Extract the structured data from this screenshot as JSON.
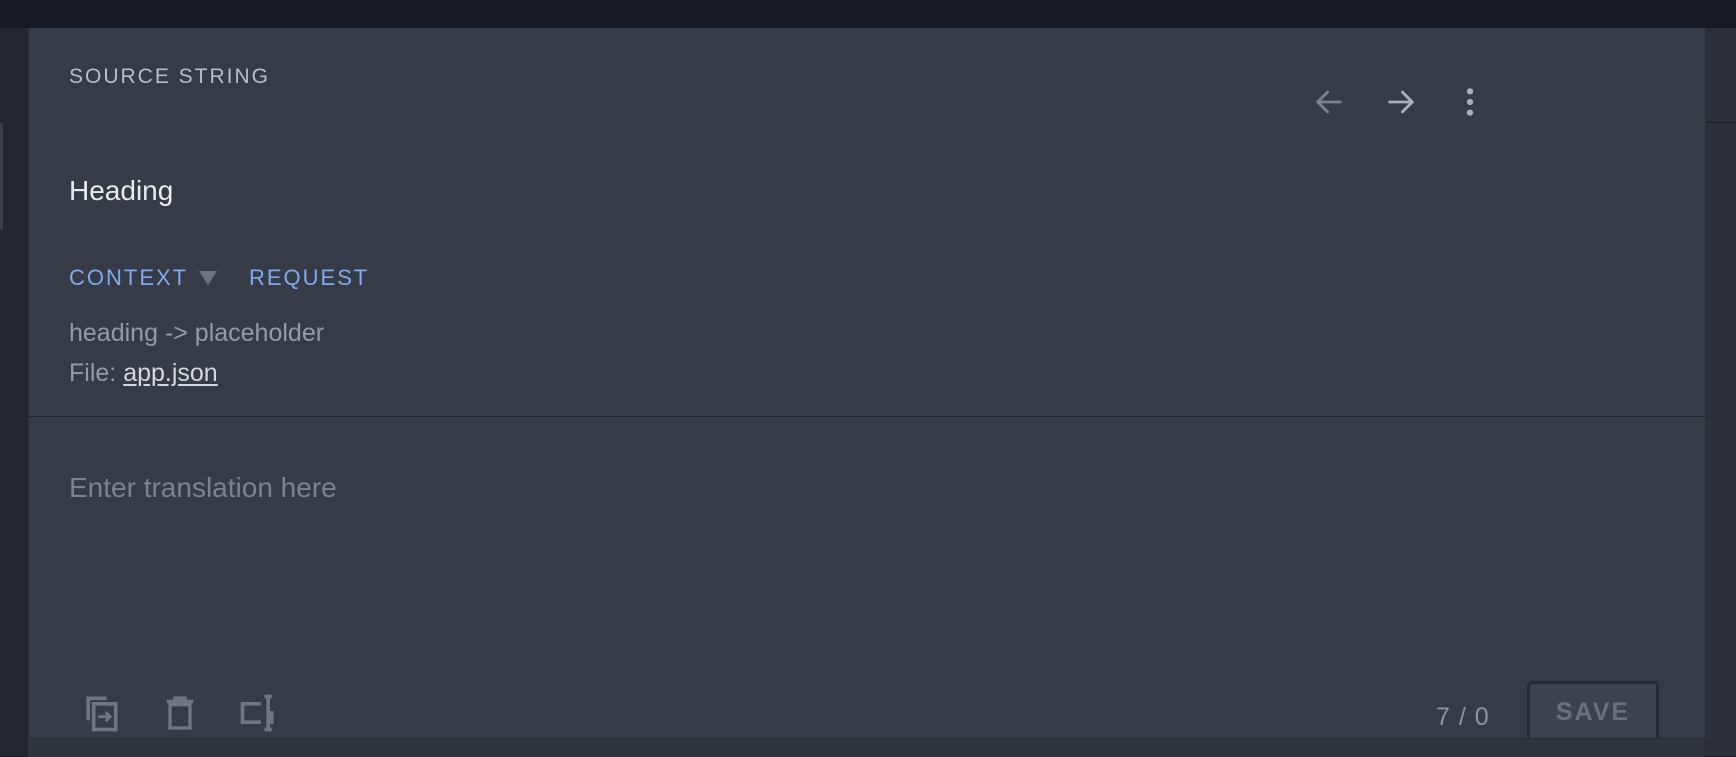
{
  "header": {
    "title": "SOURCE STRING",
    "prev_icon": "arrow-left-icon",
    "next_icon": "arrow-right-icon",
    "menu_icon": "more-vertical-icon"
  },
  "source": {
    "text": "Heading"
  },
  "tabs": {
    "context": "CONTEXT",
    "request": "REQUEST"
  },
  "context": {
    "key_path": "heading -> placeholder",
    "file_label": "File:",
    "file_name": "app.json"
  },
  "translation": {
    "value": "",
    "placeholder": "Enter translation here"
  },
  "toolbar": {
    "copy_icon": "copy-source-icon",
    "delete_icon": "trash-icon",
    "split_icon": "text-cursor-icon"
  },
  "footer": {
    "counter": "7 / 0",
    "save_label": "SAVE"
  },
  "colors": {
    "panel_bg": "#363c46",
    "accent": "#7fa9f2",
    "text_primary": "#e8ebef",
    "text_muted": "#949ba6"
  }
}
